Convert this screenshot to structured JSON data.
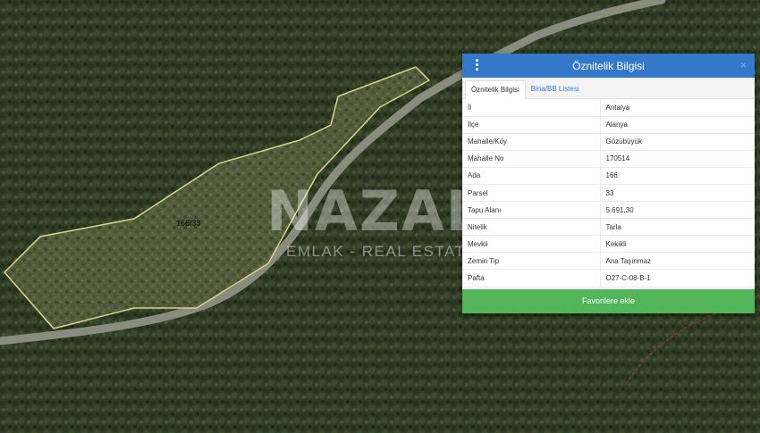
{
  "map": {
    "parcel_label": "166/33"
  },
  "watermark": {
    "logo_text": "NAZAL",
    "subtitle": "EMLAK - REAL ESTATE"
  },
  "panel": {
    "title": "Öznitelik Bilgisi",
    "close_symbol": "×",
    "tabs": [
      {
        "label": "Öznitelik Bilgisi",
        "active": true
      },
      {
        "label": "Bina/BB Listesi",
        "active": false
      }
    ],
    "rows": [
      {
        "key": "İl",
        "value": "Antalya"
      },
      {
        "key": "İlçe",
        "value": "Alanya"
      },
      {
        "key": "Mahalle/Köy",
        "value": "Gözübüyük"
      },
      {
        "key": "Mahalle No",
        "value": "170514"
      },
      {
        "key": "Ada",
        "value": "166"
      },
      {
        "key": "Parsel",
        "value": "33"
      },
      {
        "key": "Tapu Alanı",
        "value": "5.691,30"
      },
      {
        "key": "Nitelik",
        "value": "Tarla"
      },
      {
        "key": "Mevkii",
        "value": "Kekikli"
      },
      {
        "key": "Zemin Tip",
        "value": "Ana Taşınmaz"
      },
      {
        "key": "Pafta",
        "value": "O27-C-08-B-1"
      }
    ],
    "favorite_button": "Favorilere ekle"
  },
  "colors": {
    "header_blue": "#3478c9",
    "button_green": "#52b55a",
    "parcel_outline": "#d8d48a"
  }
}
